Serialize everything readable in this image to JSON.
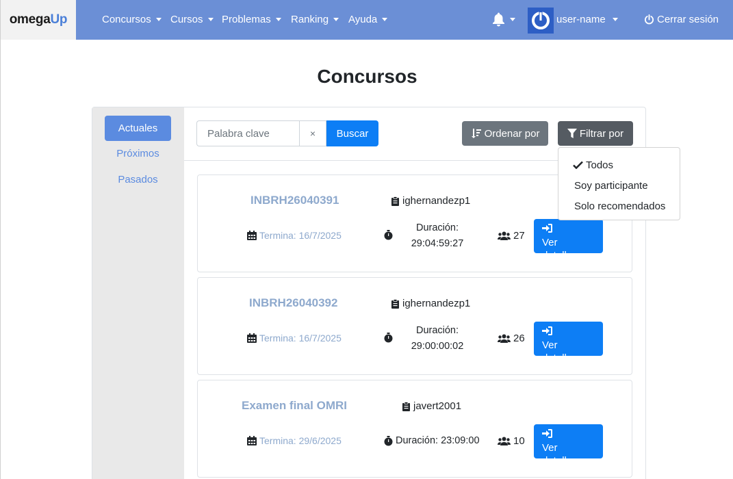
{
  "brand": {
    "name_main": "omega",
    "name_accent": "Up"
  },
  "nav": {
    "items": [
      {
        "label": "Concursos"
      },
      {
        "label": "Cursos"
      },
      {
        "label": "Problemas"
      },
      {
        "label": "Ranking"
      },
      {
        "label": "Ayuda"
      }
    ],
    "username": "user-name",
    "logout_label": "Cerrar sesión"
  },
  "page": {
    "title": "Concursos"
  },
  "sidebar": {
    "items": [
      {
        "label": "Actuales",
        "active": true
      },
      {
        "label": "Próximos",
        "active": false
      },
      {
        "label": "Pasados",
        "active": false
      }
    ]
  },
  "search": {
    "placeholder": "Palabra clave",
    "value": "",
    "clear_label": "×",
    "button_label": "Buscar"
  },
  "toolbar": {
    "sort_label": "Ordenar por",
    "filter_label": "Filtrar por"
  },
  "filter_menu": {
    "items": [
      {
        "label": "Todos",
        "checked": true
      },
      {
        "label": "Soy participante",
        "checked": false
      },
      {
        "label": "Solo recomendados",
        "checked": false
      }
    ]
  },
  "contests": [
    {
      "title": "INBRH26040391",
      "owner": "ighernandezp1",
      "ends": "Termina: 16/7/2025",
      "duration_label": "Duración:",
      "duration_value": "29:04:59:27",
      "participants": "27",
      "button_label": "Ver detalles"
    },
    {
      "title": "INBRH26040392",
      "owner": "ighernandezp1",
      "ends": "Termina: 16/7/2025",
      "duration_label": "Duración:",
      "duration_value": "29:00:00:02",
      "participants": "26",
      "button_label": "Ver detalles"
    },
    {
      "title": "Examen final OMRI",
      "owner": "javert2001",
      "ends": "Termina: 29/6/2025",
      "duration_label": "Duración:",
      "duration_value": "23:09:00",
      "participants": "10",
      "button_label": "Ver detalles"
    }
  ],
  "colors": {
    "navbar": "#6b8fd6",
    "primary": "#0d7ef5",
    "sidebar_active": "#5b8be0",
    "muted_link": "#8ea9cd"
  }
}
